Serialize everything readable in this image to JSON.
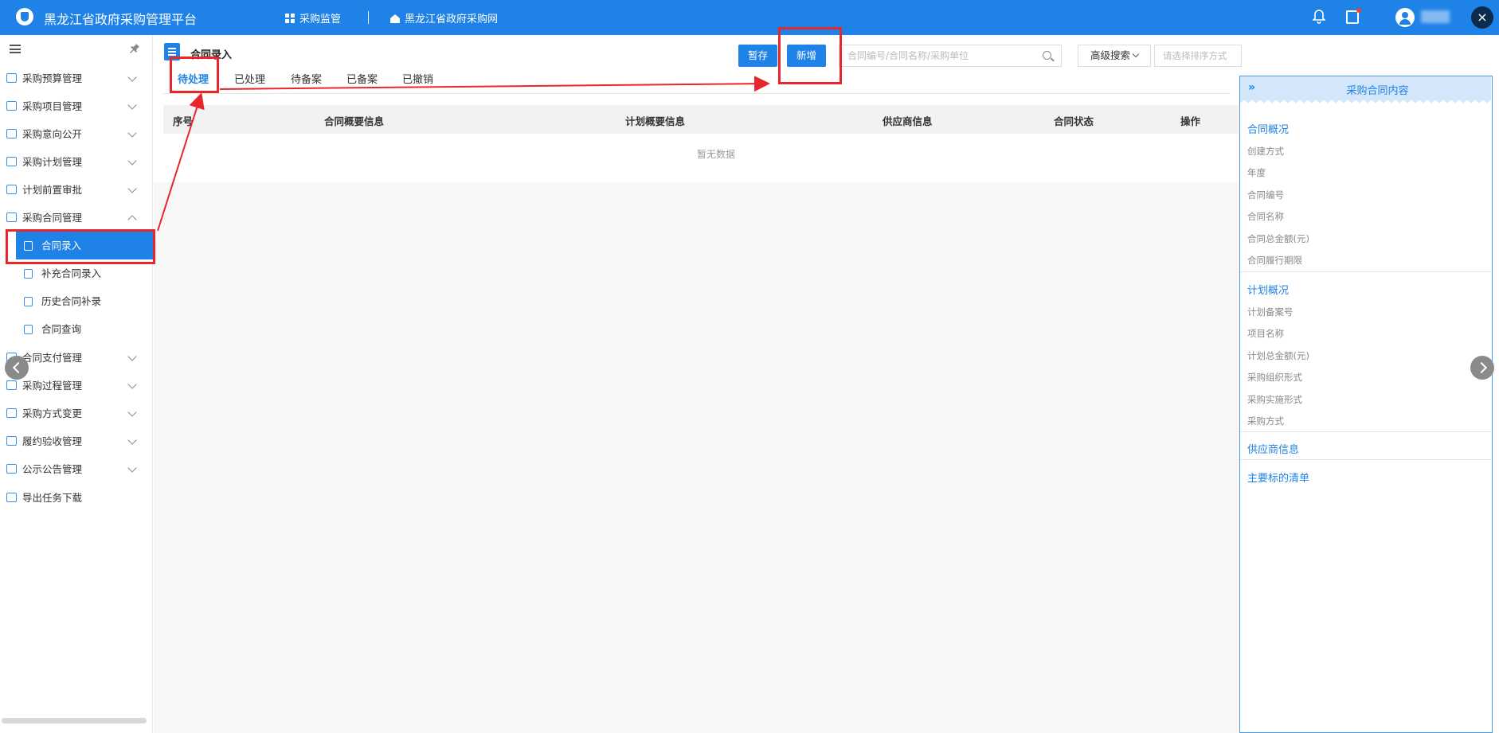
{
  "topbar": {
    "app_title": "黑龙江省政府采购管理平台",
    "nav_supervision": "采购监管",
    "nav_website": "黑龙江省政府采购网",
    "close_label": "×"
  },
  "sidebar": {
    "items": [
      {
        "label": "采购预算管理"
      },
      {
        "label": "采购项目管理"
      },
      {
        "label": "采购意向公开"
      },
      {
        "label": "采购计划管理"
      },
      {
        "label": "计划前置审批"
      },
      {
        "label": "采购合同管理"
      },
      {
        "label": "合同支付管理"
      },
      {
        "label": "采购过程管理"
      },
      {
        "label": "采购方式变更"
      },
      {
        "label": "履约验收管理"
      },
      {
        "label": "公示公告管理"
      },
      {
        "label": "导出任务下载"
      }
    ],
    "sub_items": [
      {
        "label": "合同录入"
      },
      {
        "label": "补充合同录入"
      },
      {
        "label": "历史合同补录"
      },
      {
        "label": "合同查询"
      }
    ]
  },
  "page": {
    "title": "合同录入",
    "tabs": [
      "待处理",
      "已处理",
      "待备案",
      "已备案",
      "已撤销"
    ],
    "save_draft_label": "暂存",
    "add_label": "新增",
    "search_placeholder": "合同编号/合同名称/采购单位",
    "advanced_search_label": "高级搜索",
    "sort_placeholder": "请选择排序方式"
  },
  "table": {
    "columns": [
      "序号",
      "合同概要信息",
      "计划概要信息",
      "供应商信息",
      "合同状态",
      "操作"
    ],
    "empty_text": "暂无数据"
  },
  "right_panel": {
    "collapse_icon": "»",
    "title": "采购合同内容",
    "sections": [
      {
        "title": "合同概况",
        "fields": [
          "创建方式",
          "年度",
          "合同编号",
          "合同名称",
          "合同总金额(元)",
          "合同履行期限"
        ]
      },
      {
        "title": "计划概况",
        "fields": [
          "计划备案号",
          "项目名称",
          "计划总金额(元)",
          "采购组织形式",
          "采购实施形式",
          "采购方式"
        ]
      },
      {
        "title": "供应商信息",
        "fields": []
      },
      {
        "title": "主要标的清单",
        "fields": []
      }
    ]
  },
  "colors": {
    "primary": "#1e82e6",
    "annotation_red": "#e8262b"
  }
}
